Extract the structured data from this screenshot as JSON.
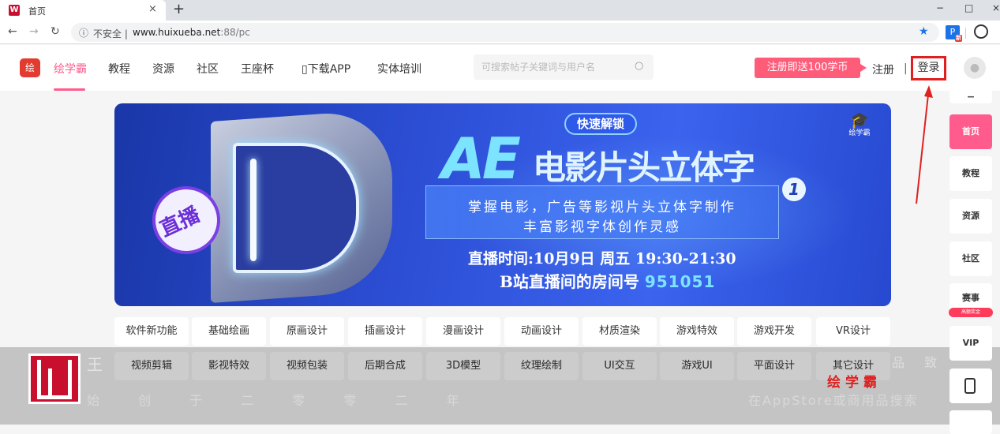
{
  "browser": {
    "tab_title": "首页",
    "tab_favicon": "W",
    "tab_close": "×",
    "new_tab": "+",
    "url_security": "不安全 |",
    "url_host": "www.huixueba.net",
    "url_rest": ":88/pc",
    "ext_badge": "新",
    "window_controls": [
      "−",
      "□",
      "×"
    ]
  },
  "header": {
    "logo_text": "绘",
    "nav": [
      "绘学霸",
      "教程",
      "资源",
      "社区",
      "王座杯",
      "▯下载APP",
      "实体培训"
    ],
    "search_placeholder": "可搜索帖子关键词与用户名",
    "promo": "注册即送100学币",
    "register": "注册",
    "separator": "|",
    "login": "登录"
  },
  "banner": {
    "badge": "快速解锁",
    "title_big": "AE",
    "title_rest": "电影片头立体字",
    "episode": "1",
    "desc_line1": "掌握电影，广告等影视片头立体字制作",
    "desc_line2": "丰富影视字体创作灵感",
    "time": "直播时间:10月9日 周五 19:30-21:30",
    "room_label": "B站直播间的房间号",
    "room_number": "951051",
    "live_label": "直播",
    "brand_small": "绘学霸",
    "slides": 5,
    "active_slide": 2
  },
  "categories": [
    [
      "软件新功能",
      "基础绘画",
      "原画设计",
      "插画设计",
      "漫画设计",
      "动画设计",
      "材质渲染",
      "游戏特效",
      "游戏开发",
      "VR设计"
    ],
    [
      "视频剪辑",
      "影视特效",
      "视频包装",
      "后期合成",
      "3D模型",
      "纹理绘制",
      "UI交互",
      "游戏UI",
      "平面设计",
      "其它设计"
    ]
  ],
  "watermark": {
    "line1": "王",
    "line2": "始 创 于 二 零 零 二 年",
    "right1": "品 致",
    "store": "在AppStore或商用品搜索",
    "brand": "绘学霸"
  },
  "sidebar": [
    "首页",
    "教程",
    "资源",
    "社区",
    "赛事",
    "VIP"
  ],
  "sidebar_badge": "高额奖金",
  "colors": {
    "accent": "#ff5c8d",
    "promo": "#ff5c7a",
    "annotation": "#e02020",
    "banner": "#2d4fd6"
  }
}
